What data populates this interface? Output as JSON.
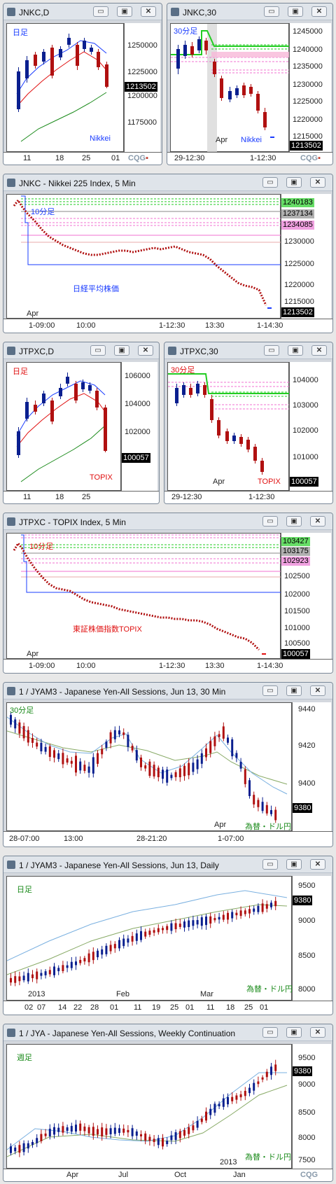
{
  "windows": [
    {
      "title": "JNKC,D",
      "label_left": "日足",
      "label_right": "Nikkei",
      "prices": [
        "1250000",
        "1225000",
        "1200000",
        "1175000"
      ],
      "last": "1213502",
      "dates": [
        "11",
        "18",
        "25",
        "01"
      ]
    },
    {
      "title": "JNKC,30",
      "label_left": "30分足",
      "label_right": "Nikkei",
      "prices": [
        "1245000",
        "1240000",
        "1235000",
        "1230000",
        "1225000",
        "1220000",
        "1215000"
      ],
      "last": "1213502",
      "month": "Apr",
      "dates": [
        "29-12:30",
        "1-12:30"
      ]
    },
    {
      "title": "JNKC - Nikkei 225 Index, 5 Min",
      "label_left": "10分足",
      "label_center": "日経平均株価",
      "prices": [
        "1230000",
        "1225000",
        "1220000",
        "1215000"
      ],
      "tags": [
        "1240183",
        "1237134",
        "1234085"
      ],
      "last": "1213502",
      "month": "Apr",
      "dates": [
        "1-09:00",
        "10:00",
        "1-12:30",
        "13:30",
        "1-14:30"
      ]
    },
    {
      "title": "JTPXC,D",
      "label_left": "日足",
      "label_right": "TOPIX",
      "prices": [
        "106000",
        "104000",
        "102000"
      ],
      "last": "100057",
      "dates": [
        "11",
        "18",
        "25"
      ]
    },
    {
      "title": "JTPXC,30",
      "label_left": "30分足",
      "label_right": "TOPIX",
      "prices": [
        "104000",
        "103000",
        "102000",
        "101000"
      ],
      "last": "100057",
      "month": "Apr",
      "dates": [
        "29-12:30",
        "1-12:30"
      ]
    },
    {
      "title": "JTPXC - TOPIX Index, 5 Min",
      "label_left": "10分足",
      "label_center": "東証株価指数TOPIX",
      "prices": [
        "102500",
        "102000",
        "101500",
        "101000",
        "100500"
      ],
      "tags": [
        "103427",
        "103175",
        "102923"
      ],
      "last": "100057",
      "month": "Apr",
      "dates": [
        "1-09:00",
        "10:00",
        "1-12:30",
        "13:30",
        "1-14:30"
      ]
    },
    {
      "title": "1 / JYAM3 - Japanese Yen-All Sessions, Jun 13, 30 Min",
      "label_left": "30分足",
      "label_right": "為替・ドル円",
      "prices": [
        "9440",
        "9420",
        "9400"
      ],
      "last": "9380",
      "month": "Apr",
      "dates": [
        "28-07:00",
        "13:00",
        "28-21:20",
        "1-07:00"
      ]
    },
    {
      "title": "1 / JYAM3 - Japanese Yen-All Sessions, Jun 13, Daily",
      "label_left": "日足",
      "label_right": "為替・ドル円",
      "prices": [
        "9500",
        "9000",
        "8500",
        "8000"
      ],
      "last": "9380",
      "months": [
        "2013",
        "Feb",
        "Mar"
      ],
      "dates": [
        "02",
        "07",
        "14",
        "22",
        "28",
        "01",
        "11",
        "19",
        "25",
        "01",
        "11",
        "18",
        "25",
        "01"
      ]
    },
    {
      "title": "1 / JYA - Japanese Yen-All Sessions, Weekly Continuation",
      "label_left": "週足",
      "label_right": "為替・ドル円",
      "prices": [
        "9500",
        "9000",
        "8500",
        "8000",
        "7500"
      ],
      "last": "9380",
      "year": "2013",
      "months": [
        "Apr",
        "Jul",
        "Oct",
        "Jan"
      ]
    }
  ],
  "brand": "CQG",
  "colors": {
    "up": "#0a1f8f",
    "down": "#b01010",
    "ma_fast": "#1a3cff",
    "ma_mid": "#e01010",
    "ma_slow": "#1a8a1a",
    "tag_green": "#66dd66",
    "tag_pink": "#f0a0e0"
  },
  "window_buttons": [
    "minimize",
    "restore",
    "close"
  ]
}
